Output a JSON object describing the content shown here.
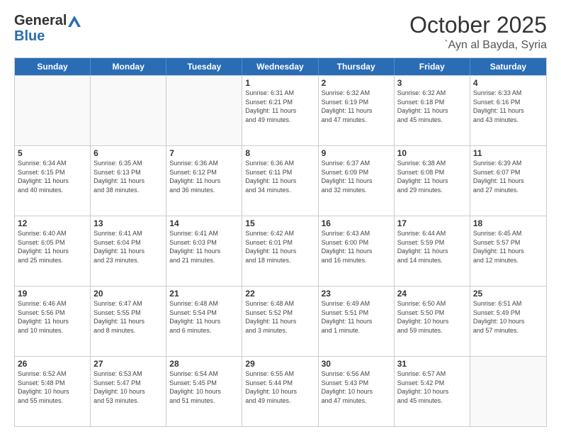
{
  "header": {
    "logo_general": "General",
    "logo_blue": "Blue",
    "month": "October 2025",
    "location": "`Ayn al Bayda, Syria"
  },
  "days_of_week": [
    "Sunday",
    "Monday",
    "Tuesday",
    "Wednesday",
    "Thursday",
    "Friday",
    "Saturday"
  ],
  "weeks": [
    [
      {
        "day": "",
        "info": ""
      },
      {
        "day": "",
        "info": ""
      },
      {
        "day": "",
        "info": ""
      },
      {
        "day": "1",
        "info": "Sunrise: 6:31 AM\nSunset: 6:21 PM\nDaylight: 11 hours\nand 49 minutes."
      },
      {
        "day": "2",
        "info": "Sunrise: 6:32 AM\nSunset: 6:19 PM\nDaylight: 11 hours\nand 47 minutes."
      },
      {
        "day": "3",
        "info": "Sunrise: 6:32 AM\nSunset: 6:18 PM\nDaylight: 11 hours\nand 45 minutes."
      },
      {
        "day": "4",
        "info": "Sunrise: 6:33 AM\nSunset: 6:16 PM\nDaylight: 11 hours\nand 43 minutes."
      }
    ],
    [
      {
        "day": "5",
        "info": "Sunrise: 6:34 AM\nSunset: 6:15 PM\nDaylight: 11 hours\nand 40 minutes."
      },
      {
        "day": "6",
        "info": "Sunrise: 6:35 AM\nSunset: 6:13 PM\nDaylight: 11 hours\nand 38 minutes."
      },
      {
        "day": "7",
        "info": "Sunrise: 6:36 AM\nSunset: 6:12 PM\nDaylight: 11 hours\nand 36 minutes."
      },
      {
        "day": "8",
        "info": "Sunrise: 6:36 AM\nSunset: 6:11 PM\nDaylight: 11 hours\nand 34 minutes."
      },
      {
        "day": "9",
        "info": "Sunrise: 6:37 AM\nSunset: 6:09 PM\nDaylight: 11 hours\nand 32 minutes."
      },
      {
        "day": "10",
        "info": "Sunrise: 6:38 AM\nSunset: 6:08 PM\nDaylight: 11 hours\nand 29 minutes."
      },
      {
        "day": "11",
        "info": "Sunrise: 6:39 AM\nSunset: 6:07 PM\nDaylight: 11 hours\nand 27 minutes."
      }
    ],
    [
      {
        "day": "12",
        "info": "Sunrise: 6:40 AM\nSunset: 6:05 PM\nDaylight: 11 hours\nand 25 minutes."
      },
      {
        "day": "13",
        "info": "Sunrise: 6:41 AM\nSunset: 6:04 PM\nDaylight: 11 hours\nand 23 minutes."
      },
      {
        "day": "14",
        "info": "Sunrise: 6:41 AM\nSunset: 6:03 PM\nDaylight: 11 hours\nand 21 minutes."
      },
      {
        "day": "15",
        "info": "Sunrise: 6:42 AM\nSunset: 6:01 PM\nDaylight: 11 hours\nand 18 minutes."
      },
      {
        "day": "16",
        "info": "Sunrise: 6:43 AM\nSunset: 6:00 PM\nDaylight: 11 hours\nand 16 minutes."
      },
      {
        "day": "17",
        "info": "Sunrise: 6:44 AM\nSunset: 5:59 PM\nDaylight: 11 hours\nand 14 minutes."
      },
      {
        "day": "18",
        "info": "Sunrise: 6:45 AM\nSunset: 5:57 PM\nDaylight: 11 hours\nand 12 minutes."
      }
    ],
    [
      {
        "day": "19",
        "info": "Sunrise: 6:46 AM\nSunset: 5:56 PM\nDaylight: 11 hours\nand 10 minutes."
      },
      {
        "day": "20",
        "info": "Sunrise: 6:47 AM\nSunset: 5:55 PM\nDaylight: 11 hours\nand 8 minutes."
      },
      {
        "day": "21",
        "info": "Sunrise: 6:48 AM\nSunset: 5:54 PM\nDaylight: 11 hours\nand 6 minutes."
      },
      {
        "day": "22",
        "info": "Sunrise: 6:48 AM\nSunset: 5:52 PM\nDaylight: 11 hours\nand 3 minutes."
      },
      {
        "day": "23",
        "info": "Sunrise: 6:49 AM\nSunset: 5:51 PM\nDaylight: 11 hours\nand 1 minute."
      },
      {
        "day": "24",
        "info": "Sunrise: 6:50 AM\nSunset: 5:50 PM\nDaylight: 10 hours\nand 59 minutes."
      },
      {
        "day": "25",
        "info": "Sunrise: 6:51 AM\nSunset: 5:49 PM\nDaylight: 10 hours\nand 57 minutes."
      }
    ],
    [
      {
        "day": "26",
        "info": "Sunrise: 6:52 AM\nSunset: 5:48 PM\nDaylight: 10 hours\nand 55 minutes."
      },
      {
        "day": "27",
        "info": "Sunrise: 6:53 AM\nSunset: 5:47 PM\nDaylight: 10 hours\nand 53 minutes."
      },
      {
        "day": "28",
        "info": "Sunrise: 6:54 AM\nSunset: 5:45 PM\nDaylight: 10 hours\nand 51 minutes."
      },
      {
        "day": "29",
        "info": "Sunrise: 6:55 AM\nSunset: 5:44 PM\nDaylight: 10 hours\nand 49 minutes."
      },
      {
        "day": "30",
        "info": "Sunrise: 6:56 AM\nSunset: 5:43 PM\nDaylight: 10 hours\nand 47 minutes."
      },
      {
        "day": "31",
        "info": "Sunrise: 6:57 AM\nSunset: 5:42 PM\nDaylight: 10 hours\nand 45 minutes."
      },
      {
        "day": "",
        "info": ""
      }
    ]
  ]
}
